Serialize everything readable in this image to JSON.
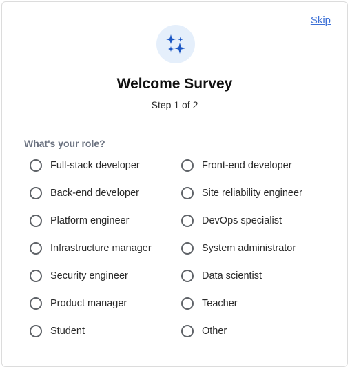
{
  "header": {
    "skip_label": "Skip",
    "icon": "sparkles-icon",
    "title": "Welcome Survey",
    "step": "Step 1 of 2"
  },
  "question": {
    "label": "What's your role?",
    "options": [
      "Full-stack developer",
      "Front-end developer",
      "Back-end developer",
      "Site reliability engineer",
      "Platform engineer",
      "DevOps specialist",
      "Infrastructure manager",
      "System administrator",
      "Security engineer",
      "Data scientist",
      "Product manager",
      "Teacher",
      "Student",
      "Other"
    ]
  },
  "colors": {
    "accent": "#1a56c4",
    "icon_bg": "#e5effb",
    "link": "#3b6fd6"
  }
}
